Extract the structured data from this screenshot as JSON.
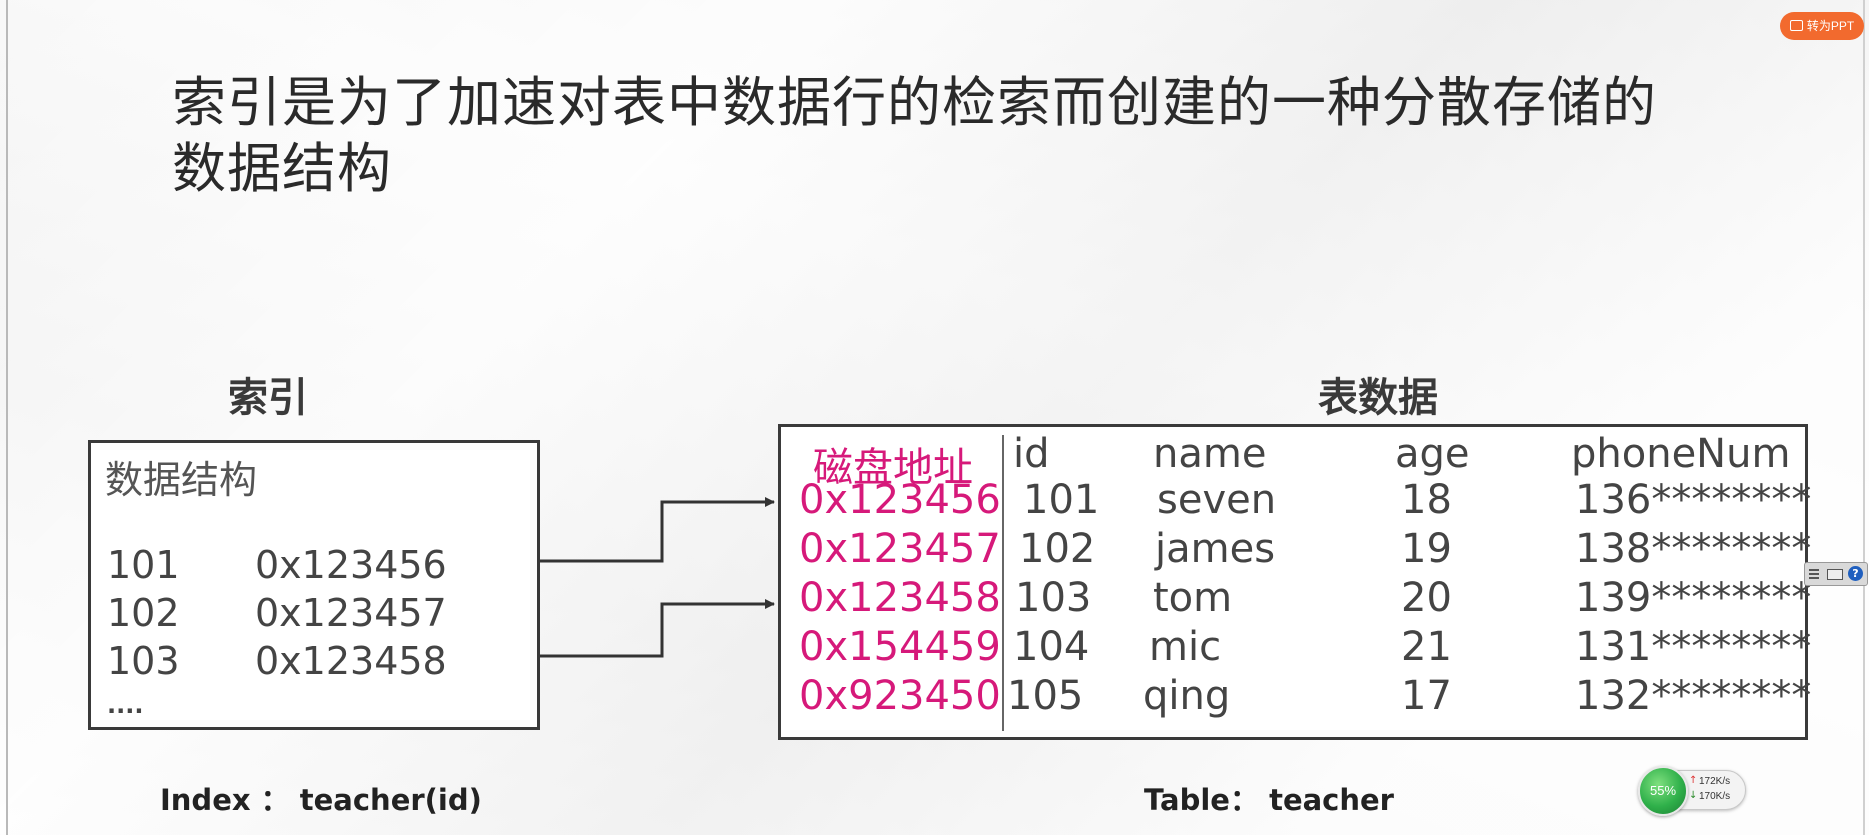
{
  "toolbar": {
    "convert_button": "转为PPT"
  },
  "slide": {
    "title_line1": "索引是为了加速对表中数据行的检索而创建的一种分散存储的",
    "title_line2": "数据结构",
    "index_heading": "索引",
    "table_heading": "表数据",
    "index_box": {
      "label": "数据结构",
      "rows": [
        {
          "key": "101",
          "addr": "0x123456"
        },
        {
          "key": "102",
          "addr": "0x123457"
        },
        {
          "key": "103",
          "addr": "0x123458"
        }
      ],
      "more": "...."
    },
    "table_box": {
      "disk_header": "磁盘地址",
      "columns": [
        "id",
        "name",
        "age",
        "phoneNum"
      ],
      "rows": [
        {
          "addr": "0x123456",
          "id": "101",
          "name": "seven",
          "age": "18",
          "phone": "136********"
        },
        {
          "addr": "0x123457",
          "id": "102",
          "name": "james",
          "age": "19",
          "phone": "138********"
        },
        {
          "addr": "0x123458",
          "id": "103",
          "name": "tom",
          "age": "20",
          "phone": "139********"
        },
        {
          "addr": "0x154459",
          "id": "104",
          "name": "mic",
          "age": "21",
          "phone": "131********"
        },
        {
          "addr": "0x923450",
          "id": "105",
          "name": "qing",
          "age": "17",
          "phone": "132********"
        }
      ]
    },
    "index_caption": "Index ： teacher(id)",
    "table_caption": "Table： teacher"
  },
  "network_widget": {
    "percent": "55%",
    "upload": "172K/s",
    "download": "170K/s"
  },
  "side_tool": {
    "help": "?"
  },
  "colors": {
    "accent_orange": "#f26a2e",
    "address_magenta": "#d6197a"
  }
}
